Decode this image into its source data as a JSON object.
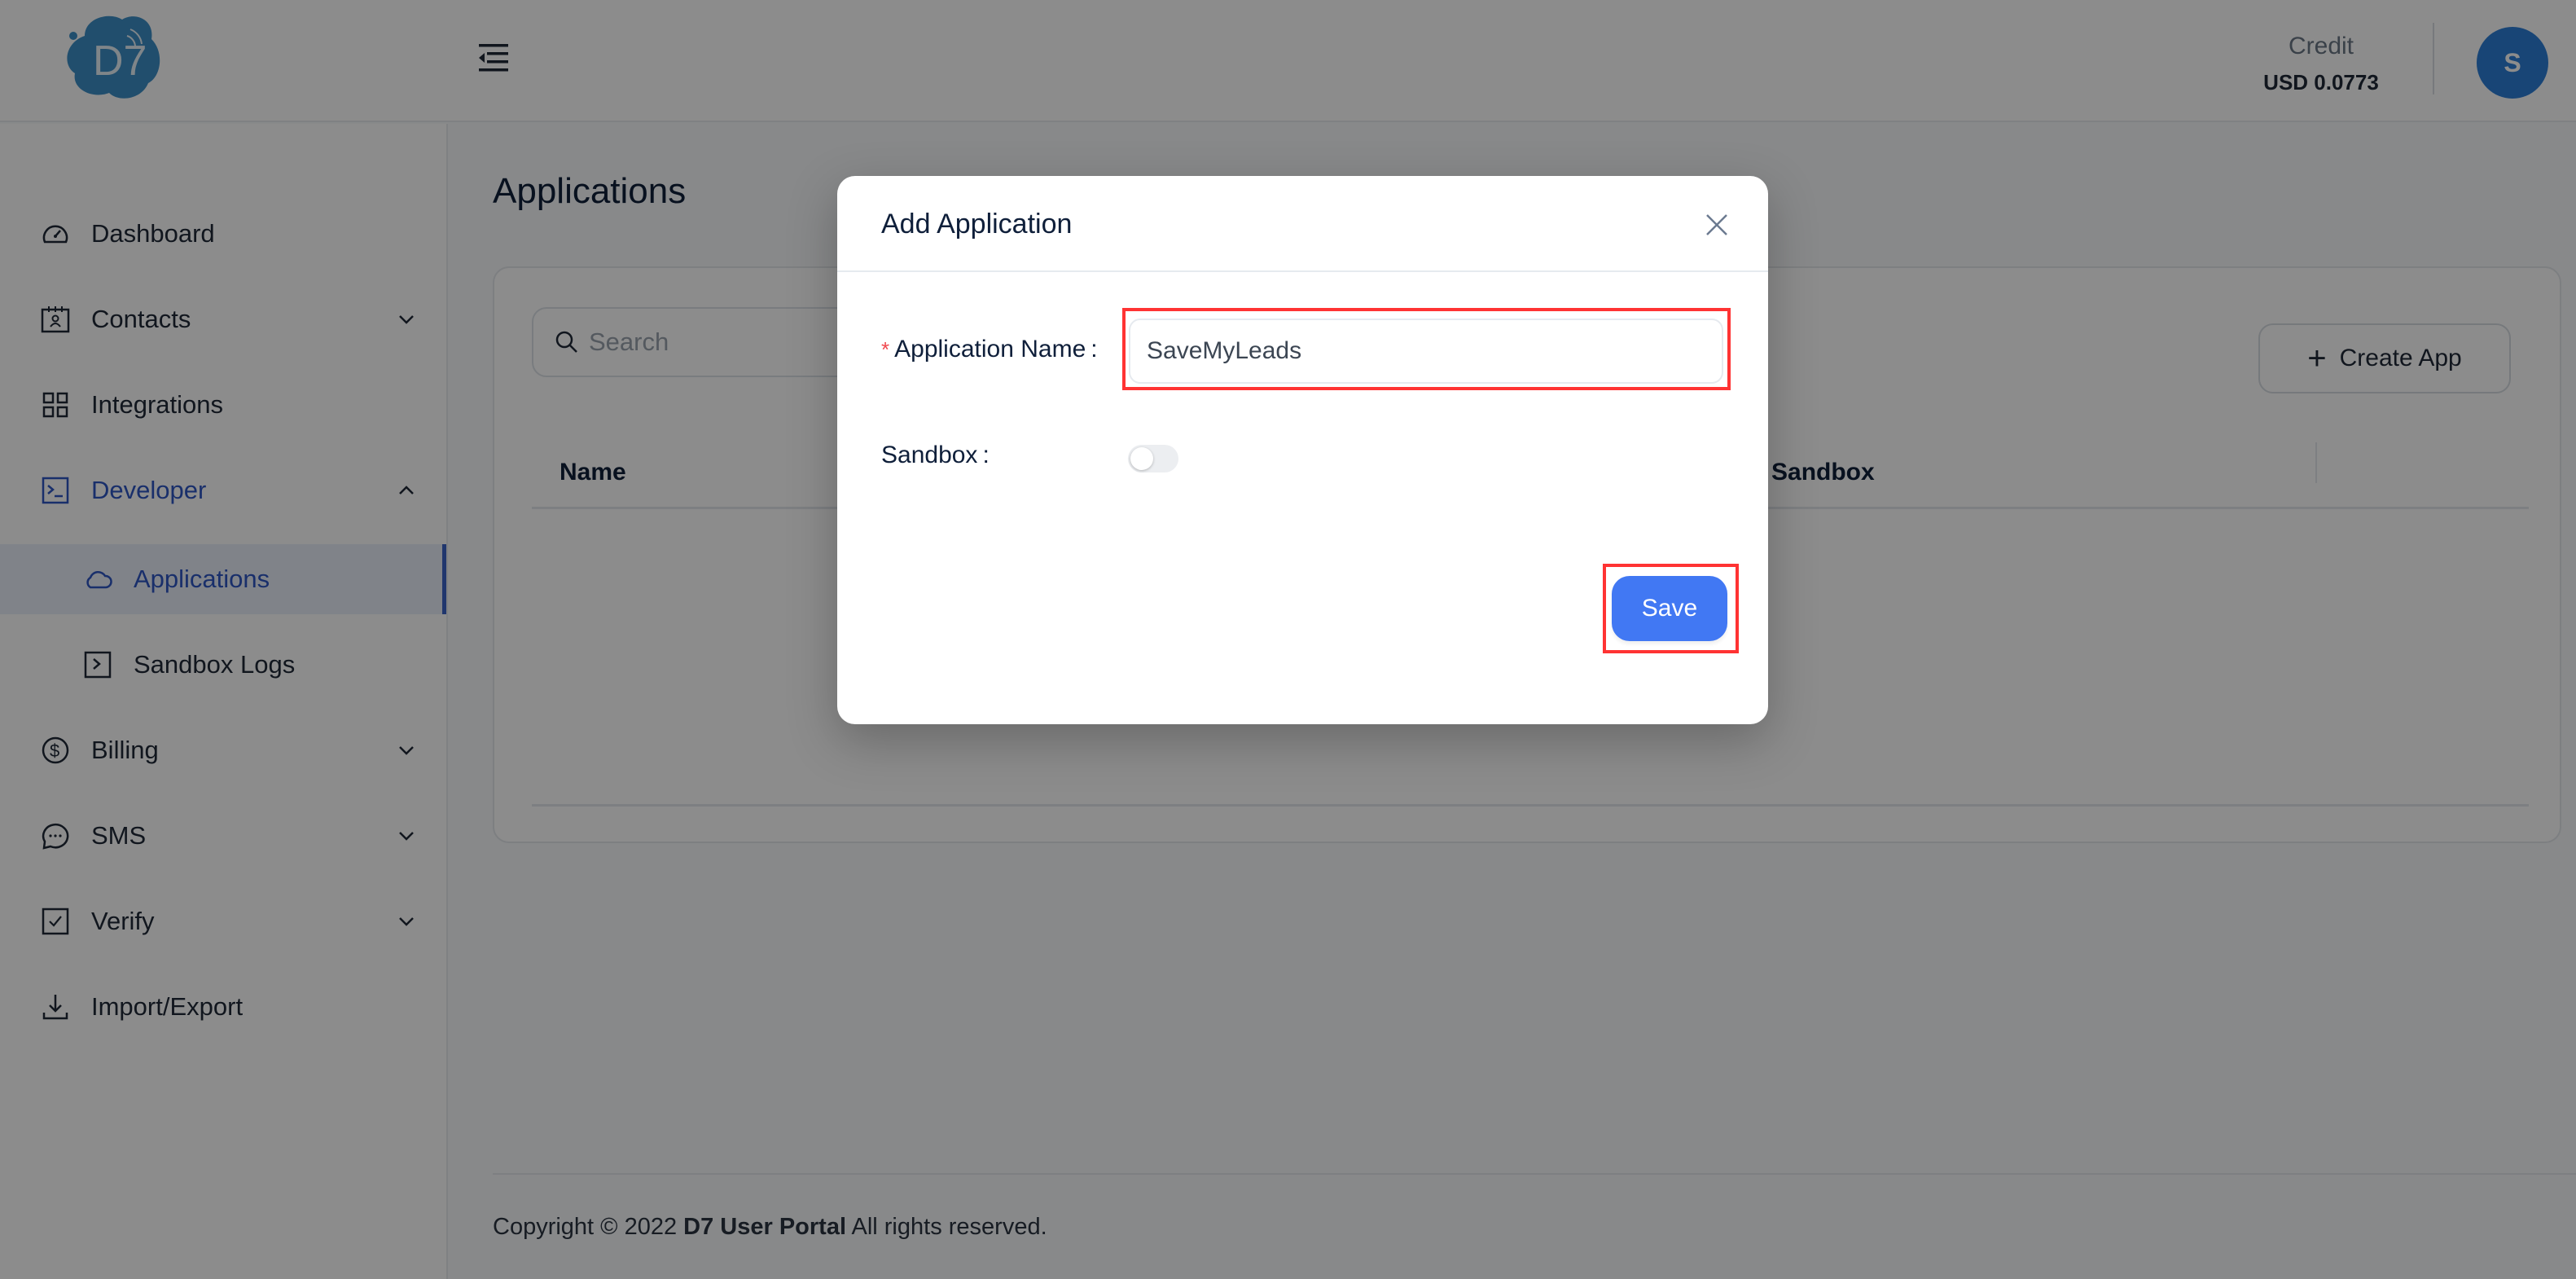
{
  "header": {
    "logo_alt": "D7",
    "credit_label": "Credit",
    "credit_value": "USD 0.0773",
    "avatar_initial": "S"
  },
  "sidebar": {
    "items": [
      {
        "label": "Dashboard",
        "icon": "dashboard-gauge-icon"
      },
      {
        "label": "Contacts",
        "icon": "contacts-icon",
        "expandable": true,
        "expanded": false
      },
      {
        "label": "Integrations",
        "icon": "grid-icon"
      },
      {
        "label": "Developer",
        "icon": "terminal-icon",
        "expandable": true,
        "expanded": true
      },
      {
        "label": "Applications",
        "icon": "cloud-icon",
        "sub": true,
        "active": true
      },
      {
        "label": "Sandbox Logs",
        "icon": "sandbox-terminal-icon",
        "sub": true
      },
      {
        "label": "Billing",
        "icon": "dollar-icon",
        "expandable": true,
        "expanded": false
      },
      {
        "label": "SMS",
        "icon": "chat-bubble-icon",
        "expandable": true,
        "expanded": false
      },
      {
        "label": "Verify",
        "icon": "checkbox-icon",
        "expandable": true,
        "expanded": false
      },
      {
        "label": "Import/Export",
        "icon": "download-icon"
      }
    ]
  },
  "main": {
    "title": "Applications",
    "search_placeholder": "Search",
    "create_button": "Create App",
    "table_headers": [
      "Name",
      "Sandbox"
    ]
  },
  "footer": {
    "prefix": "Copyright © 2022 ",
    "brand": "D7 User Portal",
    "suffix": " All rights reserved."
  },
  "modal": {
    "title": "Add Application",
    "name_label": "Application Name",
    "name_required_mark": "*",
    "name_value": "SaveMyLeads",
    "sandbox_label": "Sandbox",
    "sandbox_enabled": false,
    "label_colon": ":",
    "save_button": "Save"
  },
  "colors": {
    "accent": "#2f57c3",
    "primary_button": "#4178f3",
    "avatar": "#2d7fd8",
    "highlight_box": "#ff3333"
  }
}
